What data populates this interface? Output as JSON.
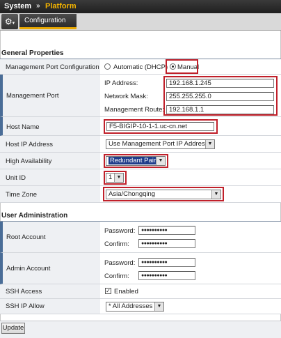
{
  "header": {
    "system": "System",
    "separator": "»",
    "page": "Platform"
  },
  "tabs": [
    {
      "label": "Configuration"
    }
  ],
  "general": {
    "title": "General Properties",
    "mgmt_port_config": {
      "label": "Management Port Configuration",
      "opt_auto": "Automatic (DHCP)",
      "opt_manual": "Manual"
    },
    "mgmt_port": {
      "label": "Management Port",
      "ip_label": "IP Address:",
      "ip_value": "192.168.1.245",
      "mask_label": "Network Mask:",
      "mask_value": "255.255.255.0",
      "route_label": "Management Route:",
      "route_value": "192.168.1.1"
    },
    "host_name": {
      "label": "Host Name",
      "value": "F5-BIGIP-10-1-1.uc-cn.net"
    },
    "host_ip": {
      "label": "Host IP Address",
      "value": "Use Management Port IP Address"
    },
    "high_availability": {
      "label": "High Availability",
      "value": "Redundant Pair"
    },
    "unit_id": {
      "label": "Unit ID",
      "value": "1"
    },
    "time_zone": {
      "label": "Time Zone",
      "value": "Asia/Chongqing"
    }
  },
  "user_admin": {
    "title": "User Administration",
    "root": {
      "label": "Root Account",
      "password_label": "Password:",
      "password_value": "●●●●●●●●●●",
      "confirm_label": "Confirm:",
      "confirm_value": "●●●●●●●●●●"
    },
    "admin": {
      "label": "Admin Account",
      "password_label": "Password:",
      "password_value": "●●●●●●●●●●",
      "confirm_label": "Confirm:",
      "confirm_value": "●●●●●●●●●●"
    },
    "ssh_access": {
      "label": "SSH Access",
      "enabled_label": "Enabled"
    },
    "ssh_ip_allow": {
      "label": "SSH IP Allow",
      "value": "* All Addresses"
    }
  },
  "update_label": "Update",
  "colors": {
    "highlight_red": "#c0202a",
    "tab_accent": "#e8a800",
    "label_bg": "#eef0f3",
    "selected_bg": "#1f3c8a"
  },
  "icons": {
    "gear": "gear-icon",
    "dropdown": "chevron-down-icon"
  }
}
